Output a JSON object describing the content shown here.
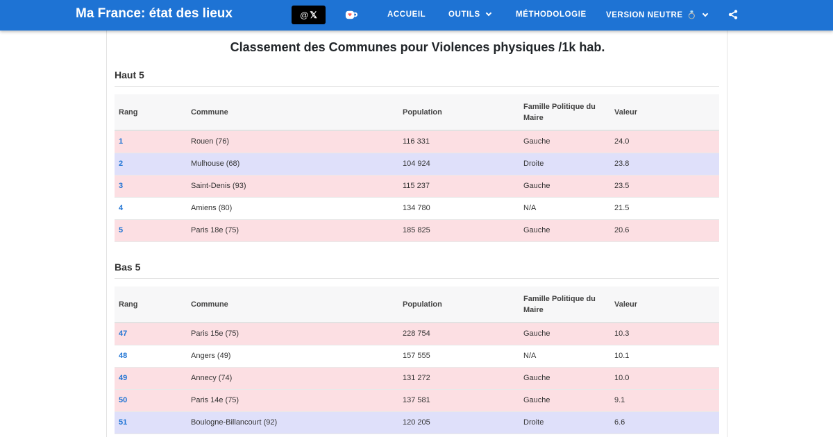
{
  "header": {
    "brand": "Ma France: état des lieux",
    "x_at": "@",
    "x_logo": "𝕏",
    "nav": {
      "accueil": "ACCUEIL",
      "outils": "OUTILS",
      "methodologie": "MÉTHODOLOGIE",
      "version": "VERSION NEUTRE",
      "version_emoji": "💍"
    }
  },
  "page_title": "Classement des Communes pour Violences physiques /1k hab.",
  "columns": {
    "rang": "Rang",
    "commune": "Commune",
    "population": "Population",
    "famille": "Famille Politique du Maire",
    "valeur": "Valeur"
  },
  "top": {
    "title": "Haut 5",
    "rows": [
      {
        "rang": "1",
        "commune": "Rouen (76)",
        "population": "116 331",
        "famille": "Gauche",
        "valeur": "24.0"
      },
      {
        "rang": "2",
        "commune": "Mulhouse (68)",
        "population": "104 924",
        "famille": "Droite",
        "valeur": "23.8"
      },
      {
        "rang": "3",
        "commune": "Saint-Denis (93)",
        "population": "115 237",
        "famille": "Gauche",
        "valeur": "23.5"
      },
      {
        "rang": "4",
        "commune": "Amiens (80)",
        "population": "134 780",
        "famille": "N/A",
        "valeur": "21.5"
      },
      {
        "rang": "5",
        "commune": "Paris 18e (75)",
        "population": "185 825",
        "famille": "Gauche",
        "valeur": "20.6"
      }
    ]
  },
  "bottom": {
    "title": "Bas 5",
    "rows": [
      {
        "rang": "47",
        "commune": "Paris 15e (75)",
        "population": "228 754",
        "famille": "Gauche",
        "valeur": "10.3"
      },
      {
        "rang": "48",
        "commune": "Angers (49)",
        "population": "157 555",
        "famille": "N/A",
        "valeur": "10.1"
      },
      {
        "rang": "49",
        "commune": "Annecy (74)",
        "population": "131 272",
        "famille": "Gauche",
        "valeur": "10.0"
      },
      {
        "rang": "50",
        "commune": "Paris 14e (75)",
        "population": "137 581",
        "famille": "Gauche",
        "valeur": "9.1"
      },
      {
        "rang": "51",
        "commune": "Boulogne-Billancourt (92)",
        "population": "120 205",
        "famille": "Droite",
        "valeur": "6.6"
      }
    ]
  },
  "colors": {
    "header_bg": "#1e73d4",
    "gauche_row": "#fcdfe3",
    "droite_row": "#dfe0fa",
    "neutre_row": "#ffffff",
    "rank_link": "#1e73d4"
  }
}
